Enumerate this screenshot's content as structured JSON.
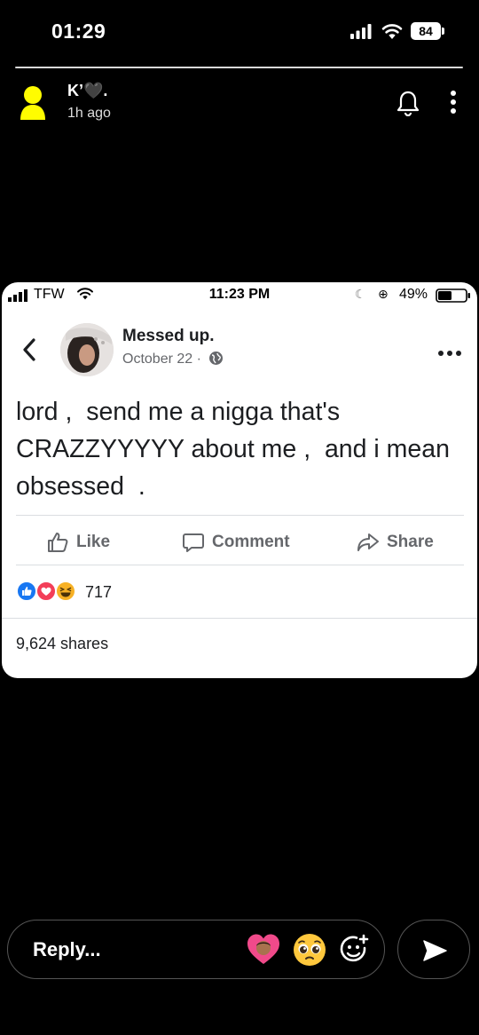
{
  "status_bar": {
    "time": "01:29",
    "battery": "84"
  },
  "story": {
    "user_name": "K’🖤.",
    "time_ago": "1h ago"
  },
  "embedded_post": {
    "status_bar": {
      "carrier": "TFW",
      "time": "11:23 PM",
      "battery_pct": "49%"
    },
    "author": "Messed up.",
    "date": "October 22 ·",
    "text": "lord ,  send me a nigga that's CRAZZYYYYY about me ,  and i mean obsessed  .",
    "actions": {
      "like": "Like",
      "comment": "Comment",
      "share": "Share"
    },
    "reaction_count": "717",
    "shares": "9,624 shares",
    "colors": {
      "like_blue": "#1877f2",
      "love_red": "#f33e58",
      "haha_yellow": "#f7b125"
    }
  },
  "reply_bar": {
    "placeholder": "Reply..."
  },
  "colors": {
    "background": "#000000",
    "ghost_yellow": "#fffc00"
  }
}
